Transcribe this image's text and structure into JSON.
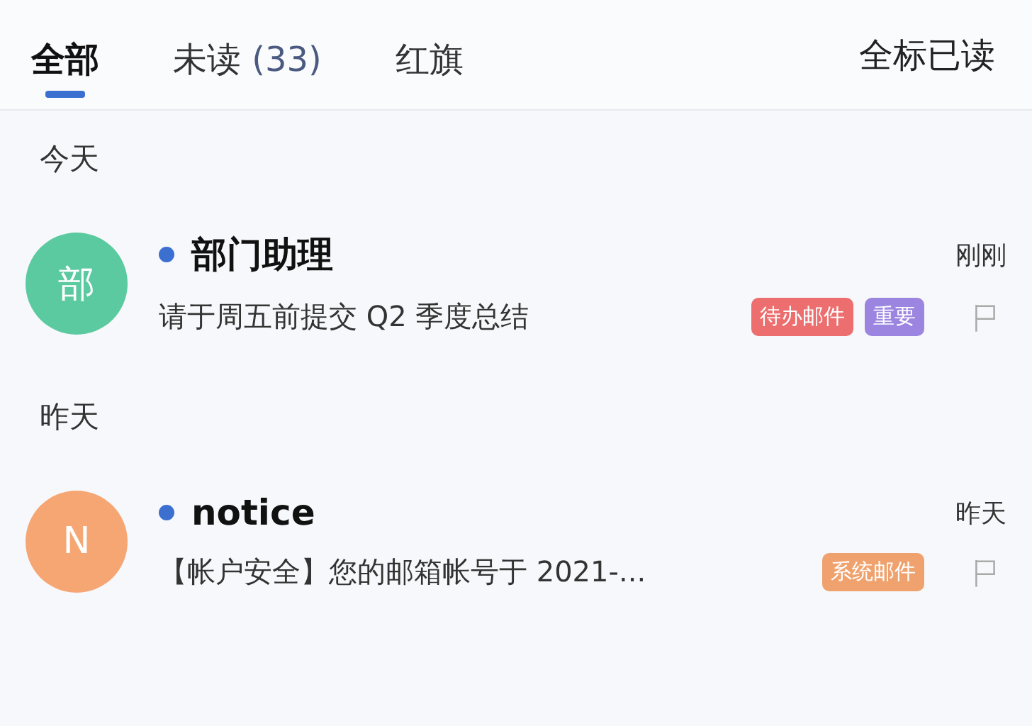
{
  "tabs": [
    {
      "label": "全部",
      "selected": true
    },
    {
      "label": "未读",
      "count": "(33)",
      "selected": false
    },
    {
      "label": "红旗",
      "selected": false
    }
  ],
  "mark_all_read": "全标已读",
  "sections": [
    {
      "title": "今天",
      "messages": [
        {
          "avatar": "部",
          "color": "#5ccaa0",
          "unread": true,
          "sender": "部门助理",
          "subject": "请于周五前提交 Q2 季度总结",
          "tags": [
            {
              "label": "待办邮件",
              "color": "#ec6e6e"
            },
            {
              "label": "重要",
              "color": "#9b85e0"
            }
          ],
          "time": "刚刚",
          "flagged": false
        }
      ]
    },
    {
      "title": "昨天",
      "messages": [
        {
          "avatar": "N",
          "color": "#f6a673",
          "unread": true,
          "sender": "notice",
          "subject": "【帐户安全】您的邮箱帐号于 2021-...",
          "tags": [
            {
              "label": "系统邮件",
              "color": "#f0a26e"
            }
          ],
          "time": "昨天",
          "flagged": false
        }
      ]
    }
  ]
}
